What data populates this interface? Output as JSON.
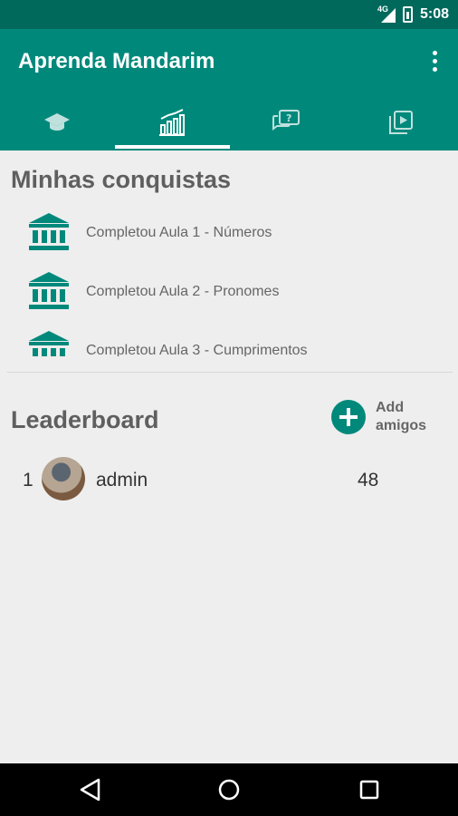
{
  "status_bar": {
    "network": "4G",
    "time": "5:08"
  },
  "app": {
    "title": "Aprenda Mandarim"
  },
  "tabs": [
    {
      "icon": "graduation-cap-icon"
    },
    {
      "icon": "leaderboard-chart-icon",
      "active": true
    },
    {
      "icon": "quiz-chat-icon"
    },
    {
      "icon": "video-library-icon"
    }
  ],
  "achievements": {
    "title": "Minhas conquistas",
    "items": [
      {
        "label": "Completou Aula 1 - Números",
        "icon": "institution-icon"
      },
      {
        "label": "Completou Aula 2 - Pronomes",
        "icon": "institution-icon"
      },
      {
        "label": "Completou Aula 3 - Cumprimentos",
        "icon": "institution-icon"
      }
    ]
  },
  "leaderboard": {
    "title": "Leaderboard",
    "add_friends_label": "Add amigos",
    "rows": [
      {
        "rank": "1",
        "name": "admin",
        "score": "48"
      }
    ]
  },
  "colors": {
    "primary": "#00897b",
    "primary_dark": "#00695c",
    "background": "#eeeeee"
  }
}
